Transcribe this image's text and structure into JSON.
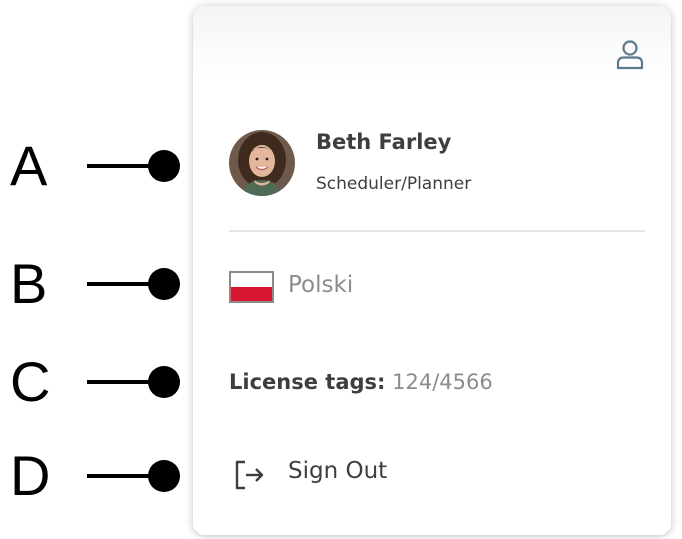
{
  "callouts": [
    {
      "letter": "A"
    },
    {
      "letter": "B"
    },
    {
      "letter": "C"
    },
    {
      "letter": "D"
    }
  ],
  "user_menu": {
    "profile_icon": "user-outline-icon",
    "user": {
      "name": "Beth Farley",
      "role": "Scheduler/Planner",
      "avatar": "user-avatar-photo"
    },
    "language": {
      "label": "Polski",
      "flag_icon": "poland-flag-icon",
      "flag_colors": {
        "top": "#ffffff",
        "bottom": "#d7172f"
      }
    },
    "license": {
      "label": "License tags:",
      "value": "124/4566"
    },
    "sign_out": {
      "label": "Sign Out",
      "icon": "sign-out-icon"
    }
  },
  "colors": {
    "text_primary": "#3e3e3e",
    "text_muted": "#8c8c8c",
    "icon_blue": "#5b7a8c",
    "divider": "#e4e4e4"
  }
}
